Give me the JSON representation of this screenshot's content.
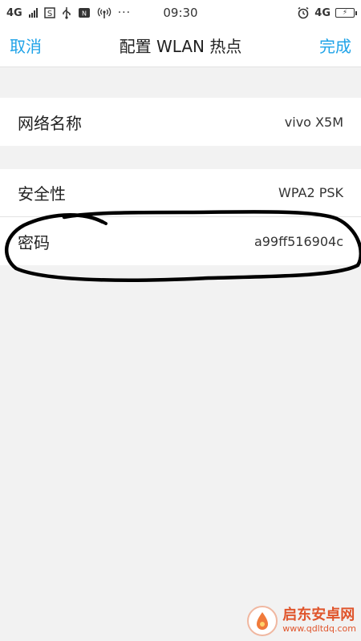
{
  "status_bar": {
    "network_left": "4G",
    "time": "09:30",
    "network_right": "4G",
    "icons": [
      "signal-icon",
      "sim-s-icon",
      "usb-icon",
      "vpn-icon",
      "hotspot-icon",
      "alarm-icon",
      "battery-charging-icon"
    ]
  },
  "nav": {
    "cancel_label": "取消",
    "title": "配置 WLAN 热点",
    "done_label": "完成"
  },
  "settings": {
    "network_name": {
      "label": "网络名称",
      "value": "vivo X5M"
    },
    "security": {
      "label": "安全性",
      "value": "WPA2 PSK"
    },
    "password": {
      "label": "密码",
      "value": "a99ff516904c"
    }
  },
  "watermark": {
    "title": "启东安卓网",
    "url": "www.qdltdq.com"
  },
  "colors": {
    "accent": "#1fa3e8",
    "background": "#f2f2f2",
    "row": "#ffffff",
    "annotation": "#000000",
    "watermark": "#e0552c"
  }
}
